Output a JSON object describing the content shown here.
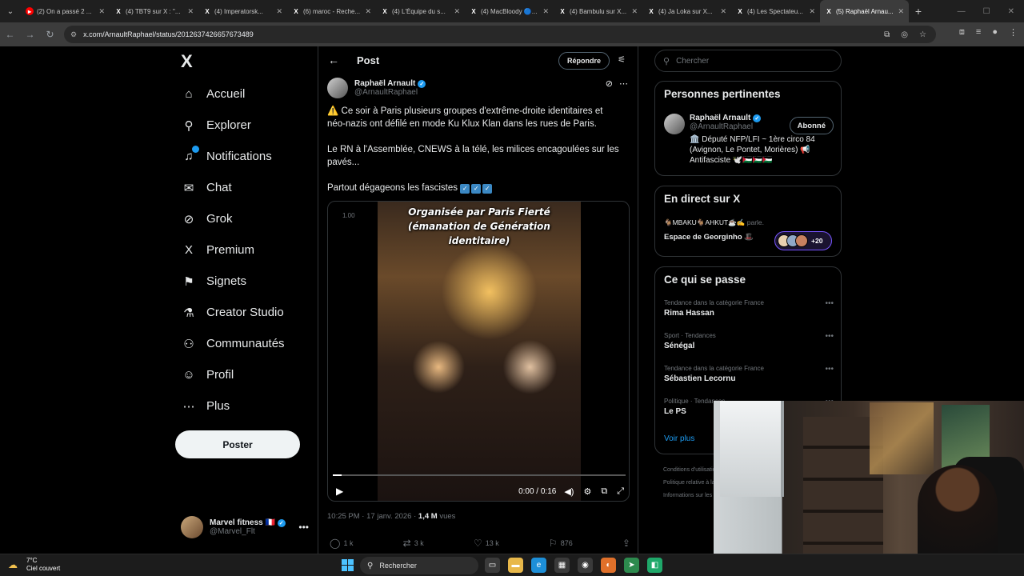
{
  "browser": {
    "tabs": [
      {
        "label": "(2) On a passé 2 ...",
        "icon": "youtube-icon",
        "active": false
      },
      {
        "label": "(4) TBT9 sur X : \"...",
        "icon": "x-icon",
        "active": false
      },
      {
        "label": "(4) Imperatorsk...",
        "icon": "x-icon",
        "active": false
      },
      {
        "label": "(6) maroc - Reche...",
        "icon": "x-icon",
        "active": false
      },
      {
        "label": "(4) L'Équipe du s...",
        "icon": "x-icon",
        "active": false
      },
      {
        "label": "(4) MacBloody 🔵...",
        "icon": "x-icon",
        "active": false
      },
      {
        "label": "(4) Bambulu sur X...",
        "icon": "x-icon",
        "active": false
      },
      {
        "label": "(4) Ja Loka sur X...",
        "icon": "x-icon",
        "active": false
      },
      {
        "label": "(4) Les Spectateu...",
        "icon": "x-icon",
        "active": false
      },
      {
        "label": "(5) Raphaël Arnau...",
        "icon": "x-icon",
        "active": true
      }
    ],
    "url": "x.com/ArnaultRaphael/status/2012637426657673489"
  },
  "nav": {
    "logo": "X",
    "items": [
      {
        "label": "Accueil",
        "icon": "home-icon",
        "glyph": "⌂"
      },
      {
        "label": "Explorer",
        "icon": "search-icon",
        "glyph": "⚲"
      },
      {
        "label": "Notifications",
        "icon": "bell-icon",
        "glyph": "♫"
      },
      {
        "label": "Chat",
        "icon": "mail-icon",
        "glyph": "✉"
      },
      {
        "label": "Grok",
        "icon": "grok-icon",
        "glyph": "⊘"
      },
      {
        "label": "Premium",
        "icon": "x-premium-icon",
        "glyph": "X"
      },
      {
        "label": "Signets",
        "icon": "bookmark-icon",
        "glyph": "⚑"
      },
      {
        "label": "Creator Studio",
        "icon": "creator-studio-icon",
        "glyph": "⚗"
      },
      {
        "label": "Communautés",
        "icon": "communities-icon",
        "glyph": "⚇"
      },
      {
        "label": "Profil",
        "icon": "profile-icon",
        "glyph": "☺"
      },
      {
        "label": "Plus",
        "icon": "more-circle-icon",
        "glyph": "⋯"
      }
    ],
    "post_button": "Poster",
    "account": {
      "name": "Marvel fitness",
      "flag": "🇫🇷",
      "handle": "@Marvel_Flt"
    }
  },
  "post": {
    "header_title": "Post",
    "reply_button": "Répondre",
    "author": {
      "name": "Raphaël Arnault",
      "handle": "@ArnaultRaphael"
    },
    "text": [
      "⚠️ Ce soir à Paris plusieurs groupes d'extrême-droite identitaires et néo-nazis ont défilé en mode Ku Klux Klan dans les rues de Paris.",
      "Le RN à l'Assemblée, CNEWS à la télé, les milices encagoulées sur les pavés...",
      "Partout dégageons les fascistes"
    ],
    "video": {
      "caption": "Organisée par Paris Fierté (émanation de Génération identitaire)",
      "badge": "1.00",
      "time": "0:00 / 0:16",
      "progress": 0.03
    },
    "meta": {
      "time": "10:25 PM",
      "date": "17 janv. 2026",
      "views_count": "1,4 M",
      "views_label": "vues"
    },
    "actions": {
      "replies": "1 k",
      "reposts": "3 k",
      "likes": "13 k",
      "bookmarks": "876"
    }
  },
  "sidebar": {
    "search_placeholder": "Chercher",
    "relevant": {
      "title": "Personnes pertinentes",
      "name": "Raphaël Arnault",
      "handle": "@ArnaultRaphael",
      "bio": "🏛️ Député NFP/LFI ~ 1ère circo 84 (Avignon, Le Pontet, Morières) 📢 Antifasciste 🕊️🇵🇸🇵🇸🇵🇸",
      "follow_button": "Abonné"
    },
    "live": {
      "title": "En direct sur X",
      "hosts": "🐐MBAKU🐐AHKUT☕✍",
      "speaking": "parle.",
      "space_name": "Espace de Georginho 🎩",
      "listeners": "+20"
    },
    "trends": {
      "title": "Ce qui se passe",
      "items": [
        {
          "category": "Tendance dans la catégorie France",
          "name": "Rima Hassan"
        },
        {
          "category": "Sport · Tendances",
          "name": "Sénégal"
        },
        {
          "category": "Tendance dans la catégorie France",
          "name": "Sébastien Lecornu"
        },
        {
          "category": "Politique · Tendances",
          "name": "Le PS"
        }
      ],
      "see_more": "Voir plus"
    },
    "footer": [
      "Conditions d'utilisation",
      "Politique relative à la",
      "Informations sur les"
    ]
  },
  "taskbar": {
    "weather_temp": "7°C",
    "weather_desc": "Ciel couvert",
    "search_placeholder": "Rechercher"
  },
  "colors": {
    "accent": "#1d9bf0",
    "background": "#000000",
    "border": "#2f3336",
    "muted": "#71767b"
  }
}
